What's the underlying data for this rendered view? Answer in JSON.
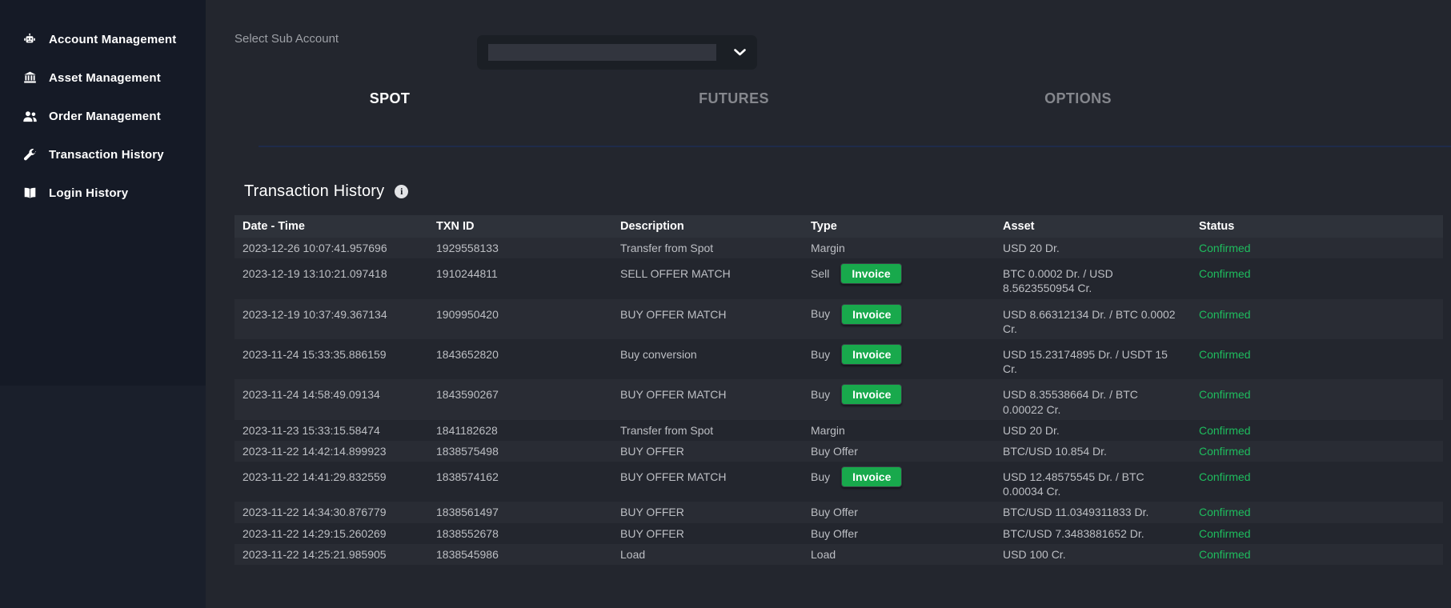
{
  "sidebar": {
    "items": [
      {
        "icon": "robot-icon",
        "label": "Account Management"
      },
      {
        "icon": "bank-icon",
        "label": "Asset Management"
      },
      {
        "icon": "users-icon",
        "label": "Order Management"
      },
      {
        "icon": "wrench-icon",
        "label": "Transaction History"
      },
      {
        "icon": "book-icon",
        "label": "Login History"
      }
    ]
  },
  "subaccount": {
    "label": "Select Sub Account",
    "selected_value": ""
  },
  "tabs": [
    {
      "label": "SPOT",
      "active": true
    },
    {
      "label": "FUTURES",
      "active": false
    },
    {
      "label": "OPTIONS",
      "active": false
    }
  ],
  "panel": {
    "title": "Transaction History"
  },
  "colors": {
    "invoice_button_green": "#18a94c",
    "status_confirmed_green": "#1ebd5e",
    "sidebar_bg": "#151a26",
    "main_bg": "#23262e",
    "header_row_bg": "#2e323a",
    "tab_underline": "#1e2b4a"
  },
  "table": {
    "columns": [
      "Date - Time",
      "TXN ID",
      "Description",
      "Type",
      "Asset",
      "Status"
    ],
    "invoice_label": "Invoice",
    "rows": [
      {
        "date": "2023-12-26 10:07:41.957696",
        "txn_id": "1929558133",
        "description": "Transfer from Spot",
        "type": "Margin",
        "has_invoice": false,
        "asset": "USD 20 Dr.",
        "status": "Confirmed"
      },
      {
        "date": "2023-12-19 13:10:21.097418",
        "txn_id": "1910244811",
        "description": "SELL OFFER MATCH",
        "type": "Sell",
        "has_invoice": true,
        "asset": "BTC 0.0002 Dr. / USD 8.5623550954 Cr.",
        "status": "Confirmed"
      },
      {
        "date": "2023-12-19 10:37:49.367134",
        "txn_id": "1909950420",
        "description": "BUY OFFER MATCH",
        "type": "Buy",
        "has_invoice": true,
        "asset": "USD 8.66312134 Dr. / BTC 0.0002 Cr.",
        "status": "Confirmed"
      },
      {
        "date": "2023-11-24 15:33:35.886159",
        "txn_id": "1843652820",
        "description": "Buy conversion",
        "type": "Buy",
        "has_invoice": true,
        "asset": "USD 15.23174895 Dr. / USDT 15 Cr.",
        "status": "Confirmed"
      },
      {
        "date": "2023-11-24 14:58:49.09134",
        "txn_id": "1843590267",
        "description": "BUY OFFER MATCH",
        "type": "Buy",
        "has_invoice": true,
        "asset": "USD 8.35538664 Dr. / BTC 0.00022 Cr.",
        "status": "Confirmed"
      },
      {
        "date": "2023-11-23 15:33:15.58474",
        "txn_id": "1841182628",
        "description": "Transfer from Spot",
        "type": "Margin",
        "has_invoice": false,
        "asset": "USD 20 Dr.",
        "status": "Confirmed"
      },
      {
        "date": "2023-11-22 14:42:14.899923",
        "txn_id": "1838575498",
        "description": "BUY OFFER",
        "type": "Buy Offer",
        "has_invoice": false,
        "asset": "BTC/USD 10.854 Dr.",
        "status": "Confirmed"
      },
      {
        "date": "2023-11-22 14:41:29.832559",
        "txn_id": "1838574162",
        "description": "BUY OFFER MATCH",
        "type": "Buy",
        "has_invoice": true,
        "asset": "USD 12.48575545 Dr. / BTC 0.00034 Cr.",
        "status": "Confirmed"
      },
      {
        "date": "2023-11-22 14:34:30.876779",
        "txn_id": "1838561497",
        "description": "BUY OFFER",
        "type": "Buy Offer",
        "has_invoice": false,
        "asset": "BTC/USD 11.0349311833 Dr.",
        "status": "Confirmed"
      },
      {
        "date": "2023-11-22 14:29:15.260269",
        "txn_id": "1838552678",
        "description": "BUY OFFER",
        "type": "Buy Offer",
        "has_invoice": false,
        "asset": "BTC/USD 7.3483881652 Dr.",
        "status": "Confirmed"
      },
      {
        "date": "2023-11-22 14:25:21.985905",
        "txn_id": "1838545986",
        "description": "Load",
        "type": "Load",
        "has_invoice": false,
        "asset": "USD 100 Cr.",
        "status": "Confirmed"
      }
    ]
  }
}
